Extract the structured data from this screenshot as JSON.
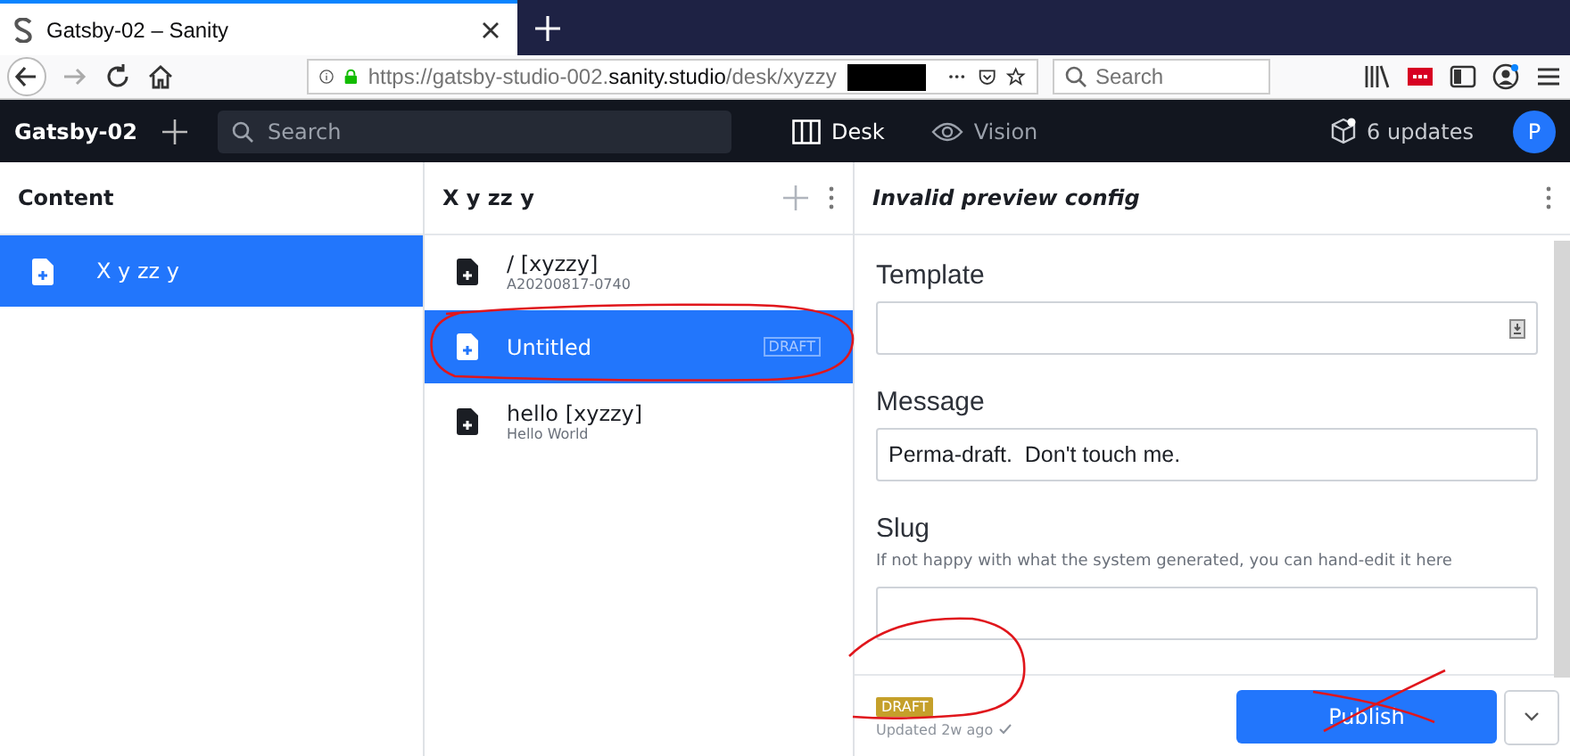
{
  "browser": {
    "tab_title": "Gatsby-02 – Sanity",
    "url_host_prefix": "https://gatsby-studio-002.",
    "url_host": "sanity.studio",
    "url_path": "/desk/xyzzy",
    "search_placeholder": "Search"
  },
  "studio": {
    "project": "Gatsby-02",
    "search_placeholder": "Search",
    "nav": [
      {
        "label": "Desk",
        "selected": true
      },
      {
        "label": "Vision",
        "selected": false
      }
    ],
    "updates": "6 updates",
    "avatar": "P"
  },
  "content_pane": {
    "title": "Content",
    "items": [
      {
        "title": "X y zz y",
        "selected": true
      }
    ]
  },
  "list_pane": {
    "title": "X y zz y",
    "items": [
      {
        "title": "/ [xyzzy]",
        "subtitle": "A20200817-0740",
        "selected": false
      },
      {
        "title": "Untitled",
        "badge": "DRAFT",
        "selected": true
      },
      {
        "title": "hello [xyzzy]",
        "subtitle": "Hello World",
        "selected": false
      }
    ]
  },
  "editor": {
    "title": "Invalid preview config",
    "fields": [
      {
        "label": "Template",
        "kind": "picker"
      },
      {
        "label": "Message",
        "kind": "text",
        "value": "Perma-draft.  Don't touch me."
      },
      {
        "label": "Slug",
        "kind": "text",
        "description": "If not happy with what the system generated, you can hand-edit it here"
      }
    ],
    "status_badge": "DRAFT",
    "updated": "Updated 2w ago",
    "publish": "Publish"
  }
}
